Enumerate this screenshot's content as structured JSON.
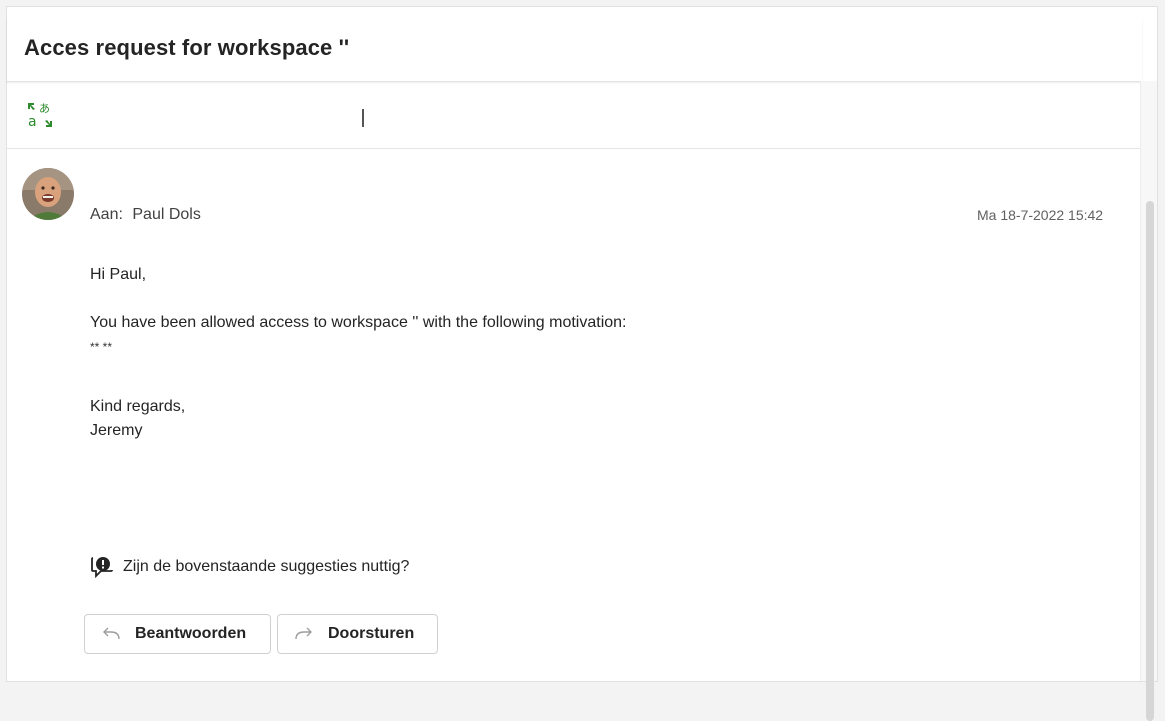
{
  "email": {
    "subject": "Acces request for workspace ''",
    "to_label": "Aan:",
    "recipient": "Paul Dols",
    "timestamp": "Ma 18-7-2022 15:42",
    "body": {
      "greeting": "Hi Paul,",
      "line1": "You have been allowed access to workspace '' with the following motivation:",
      "line2": "** **",
      "closing": "Kind regards,",
      "signature": "Jeremy"
    }
  },
  "feedback": {
    "question": "Zijn de bovenstaande suggesties nuttig?"
  },
  "actions": {
    "reply_label": "Beantwoorden",
    "forward_label": "Doorsturen"
  },
  "icons": {
    "translate": "translate-icon",
    "feedback": "feedback-icon",
    "reply": "reply-arrow-icon",
    "forward": "forward-arrow-icon"
  },
  "colors": {
    "translate_icon": "#2e8b2e",
    "button_border": "#d1d1d1"
  }
}
